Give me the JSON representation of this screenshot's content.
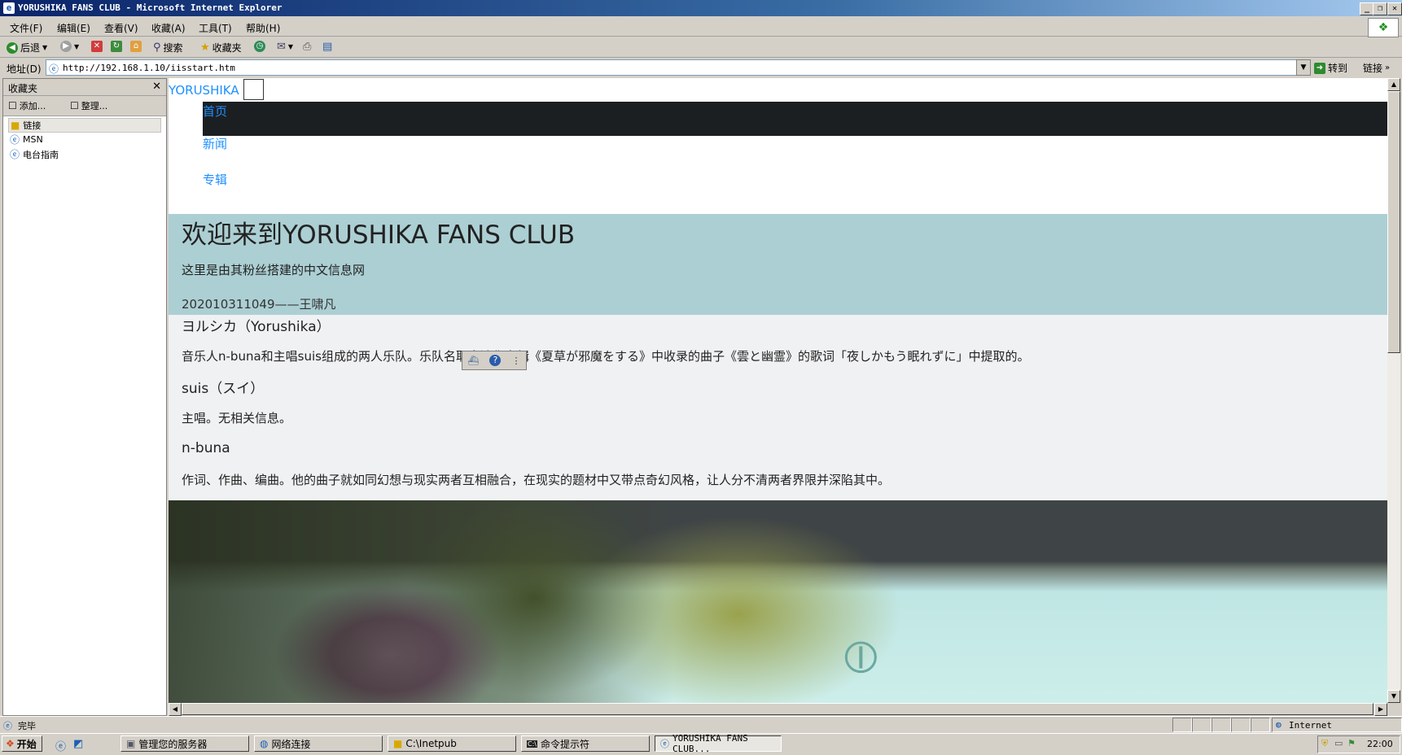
{
  "window": {
    "title": "YORUSHIKA FANS CLUB - Microsoft Internet Explorer",
    "controls": [
      "_",
      "❐",
      "✕"
    ]
  },
  "menu": [
    "文件(F)",
    "编辑(E)",
    "查看(V)",
    "收藏(A)",
    "工具(T)",
    "帮助(H)"
  ],
  "toolbar": {
    "back_label": "后退",
    "search_label": "搜索",
    "favorites_label": "收藏夹"
  },
  "address": {
    "label": "地址(D)",
    "url": "http://192.168.1.10/iisstart.htm",
    "go_label": "转到",
    "links_label": "链接"
  },
  "favorites": {
    "title": "收藏夹",
    "add_label": "添加...",
    "organize_label": "整理...",
    "items": [
      "链接",
      "MSN",
      "电台指南"
    ]
  },
  "page": {
    "brand": "YORUSHIKA",
    "nav": [
      "首页",
      "新闻",
      "专辑"
    ],
    "hero_title": "欢迎来到YORUSHIKA FANS CLUB",
    "hero_sub": "这里是由其粉丝搭建的中文信息网",
    "author": "202010311049——王啸凡",
    "band_heading": "ヨルシカ（Yorushika）",
    "band_desc": "音乐人n-buna和主唱suis组成的两人乐队。乐队名取自迷你专辑《夏草が邪魔をする》中收录的曲子《雲と幽霊》的歌词「夜しかもう眠れずに」中提取的。",
    "suis_heading": "suis（スイ）",
    "suis_desc": "主唱。无相关信息。",
    "nbuna_heading": "n-buna",
    "nbuna_desc": "作词、作曲、编曲。他的曲子就如同幻想与现实两者互相融合，在现实的题材中又带点奇幻风格，让人分不清两者界限并深陷其中。"
  },
  "status": {
    "text": "完毕",
    "zone": "Internet"
  },
  "taskbar": {
    "start_label": "开始",
    "tasks": [
      "管理您的服务器",
      "网络连接",
      "C:\\Inetpub",
      "命令提示符",
      "YORUSHIKA FANS CLUB..."
    ],
    "clock": "22:00"
  },
  "colors": {
    "link": "#1e90ff",
    "hero_bg": "#accfd3",
    "nav_bar": "#1c1f22"
  }
}
